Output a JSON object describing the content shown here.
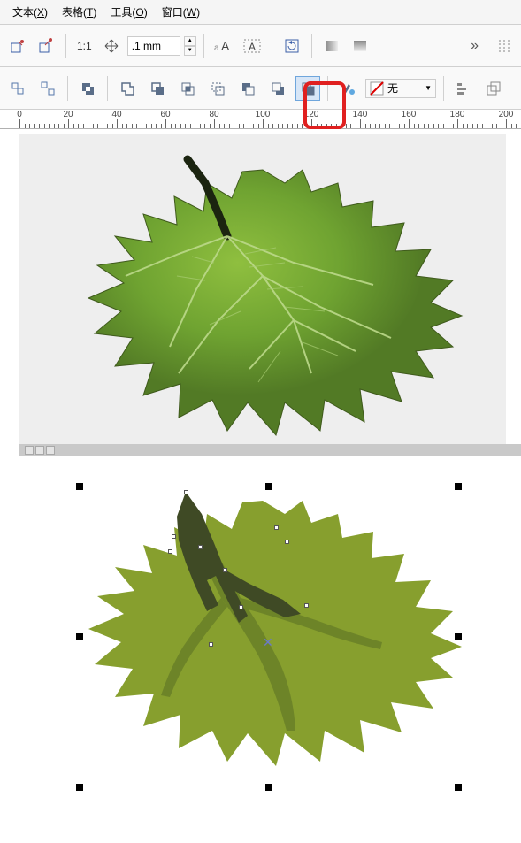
{
  "menu": {
    "text": {
      "label": "文本",
      "accel": "X"
    },
    "table": {
      "label": "表格",
      "accel": "T"
    },
    "tools": {
      "label": "工具",
      "accel": "O"
    },
    "window": {
      "label": "窗口",
      "accel": "W"
    }
  },
  "toolbar1": {
    "zoom_ratio": "1:1",
    "nudge_value": ".1 mm",
    "spinner_up": "▲",
    "spinner_down": "▼",
    "more": "»"
  },
  "toolbar2": {
    "fill_label": "无",
    "fill_arrow": "▼"
  },
  "ruler": {
    "ticks": [
      0,
      20,
      40,
      60,
      80,
      100,
      120,
      140,
      160,
      180,
      200
    ]
  },
  "chart_data": {
    "type": "none",
    "note": "Canvas content: top panel is a photographic green leaf image; bottom panel is a vectorized/posterized green leaf with black selection handles around it and white node handles on the dark stem/vein shape."
  }
}
